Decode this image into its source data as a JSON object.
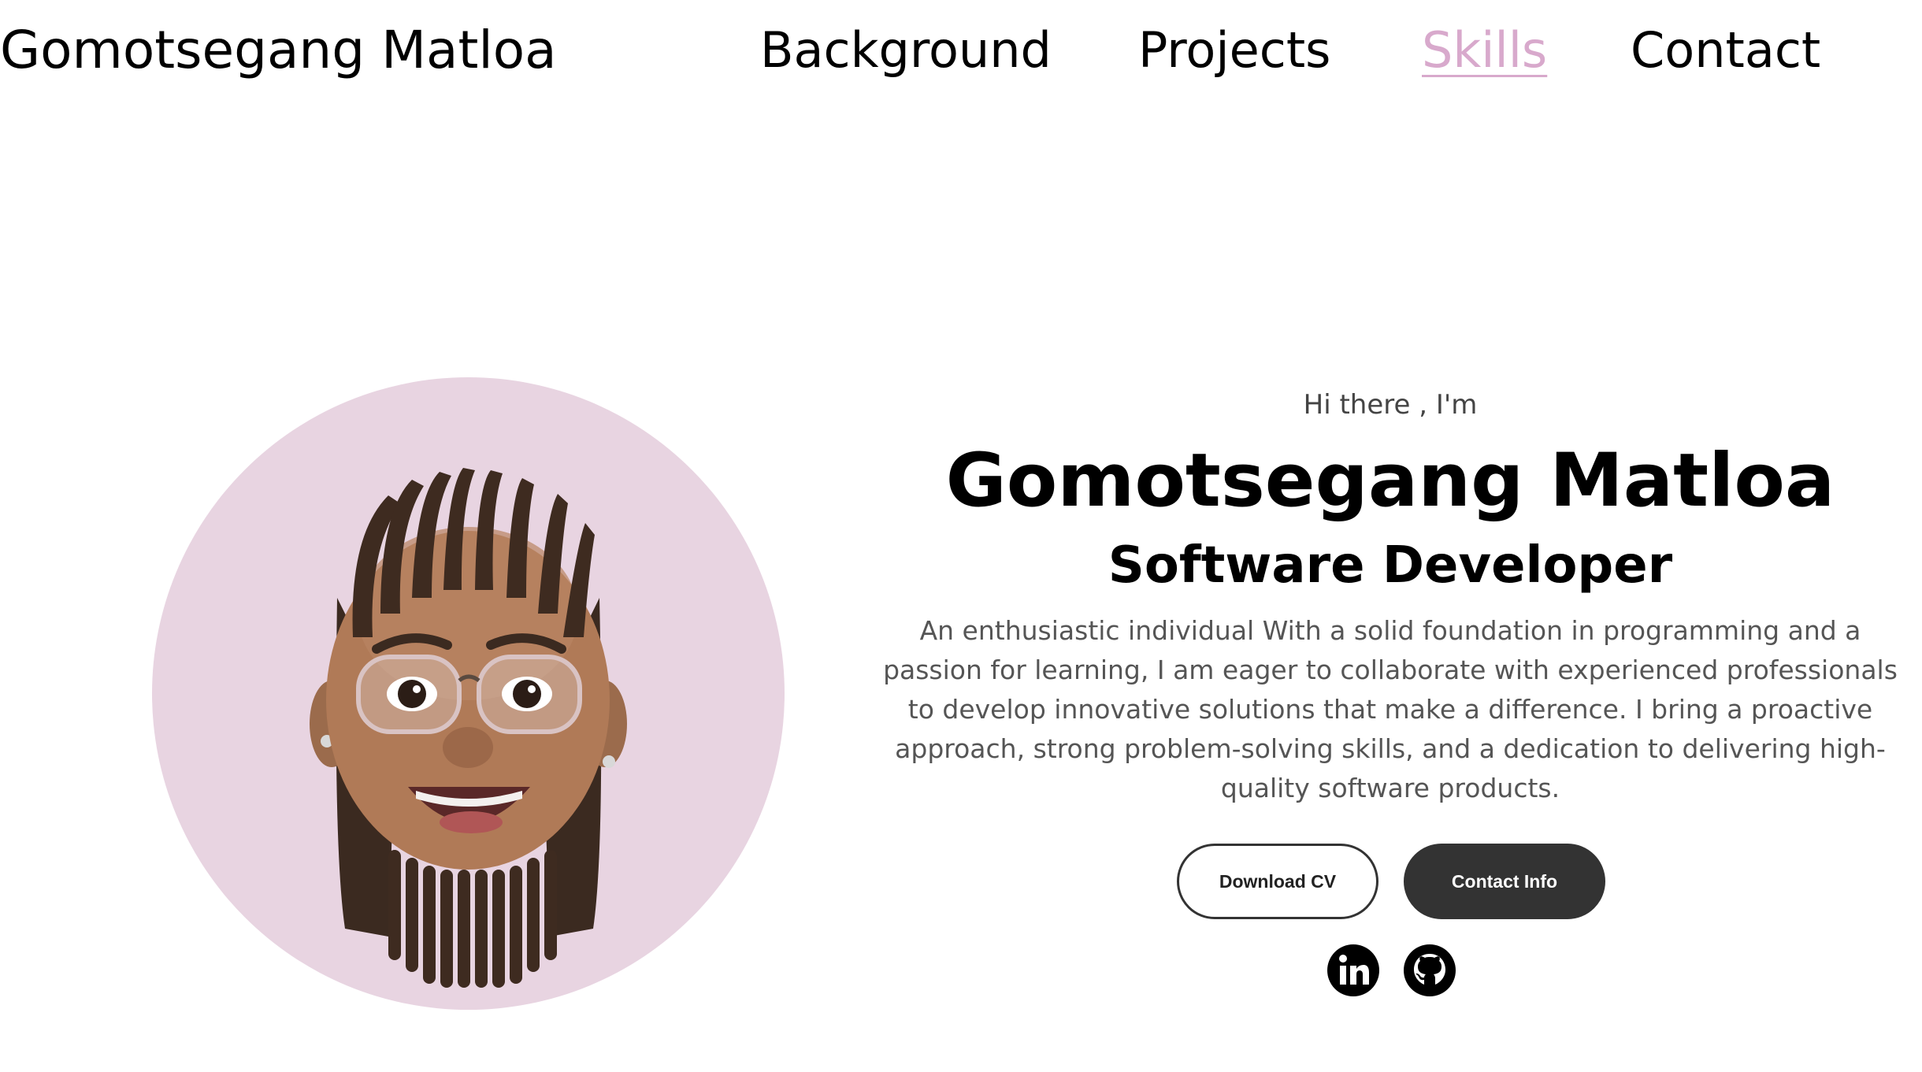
{
  "nav": {
    "logo": "Gomotsegang Matloa",
    "links": [
      {
        "label": "Background",
        "active": false
      },
      {
        "label": "Projects",
        "active": false
      },
      {
        "label": "Skills",
        "active": true
      },
      {
        "label": "Contact",
        "active": false
      }
    ]
  },
  "profile": {
    "avatar_icon": "memoji-avatar",
    "circle_color": "#e8d4e1"
  },
  "intro": {
    "greeting": "Hi there , I'm",
    "name": "Gomotsegang Matloa",
    "role": "Software Developer",
    "bio": "An enthusiastic individual With a solid foundation in programming and a passion for learning, I am eager to collaborate with experienced professionals to develop innovative solutions that make a difference. I bring a proactive approach, strong problem-solving skills, and a dedication to delivering high-quality software products."
  },
  "buttons": {
    "download_cv": "Download CV",
    "contact_info": "Contact Info"
  },
  "social": [
    {
      "icon": "linkedin-icon"
    },
    {
      "icon": "github-icon"
    }
  ],
  "colors": {
    "accent": "#d8a9cc",
    "button_dark": "#333333",
    "text_muted": "#555555"
  }
}
